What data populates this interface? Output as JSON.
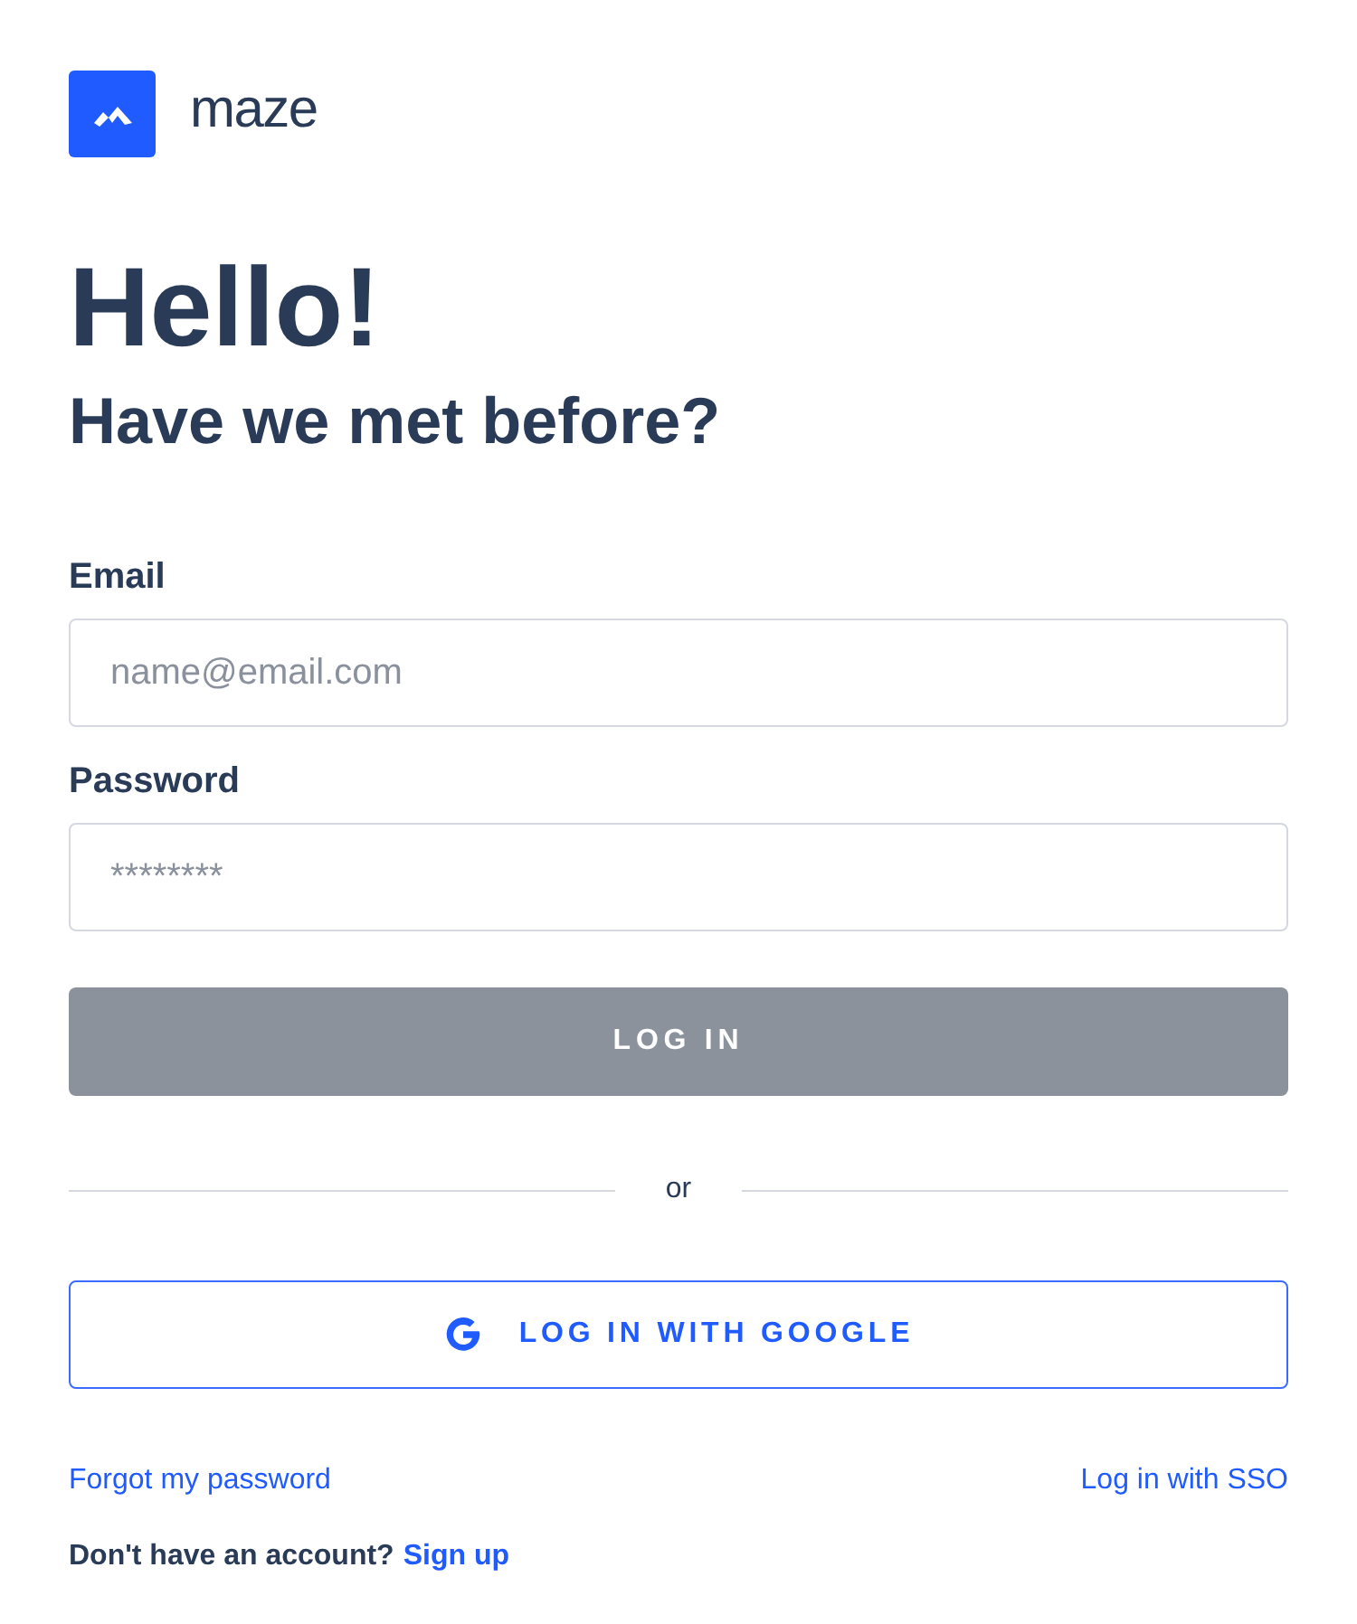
{
  "brand": {
    "name": "maze"
  },
  "heading": {
    "title": "Hello!",
    "subtitle": "Have we met before?"
  },
  "fields": [
    {
      "label": "Email",
      "placeholder": "name@email.com"
    },
    {
      "label": "Password",
      "placeholder": "********"
    }
  ],
  "login_button": {
    "label": "LOG IN",
    "disabled": true
  },
  "divider": "or",
  "google_button": {
    "label": "LOG IN WITH GOOGLE"
  },
  "links": {
    "forgot": "Forgot my password",
    "sso": "Log in with SSO"
  },
  "signup": {
    "prompt": "Don't have an account?",
    "link": "Sign up"
  }
}
